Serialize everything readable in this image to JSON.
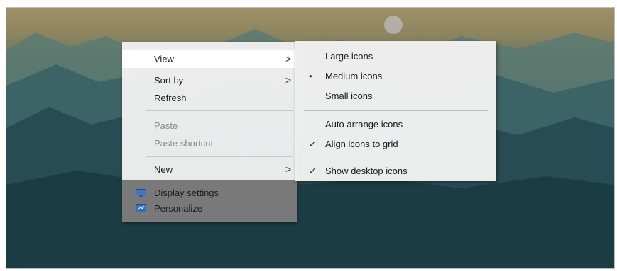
{
  "context_menu": {
    "items": [
      {
        "label": "View",
        "arrow": ">",
        "state": "highlighted"
      },
      {
        "label": "Sort by",
        "arrow": ">"
      },
      {
        "label": "Refresh"
      },
      {
        "label": "Paste",
        "state": "disabled"
      },
      {
        "label": "Paste shortcut",
        "state": "disabled"
      },
      {
        "label": "New",
        "arrow": ">"
      }
    ],
    "extra_items": [
      {
        "label": "Display settings",
        "icon": "display-settings-icon"
      },
      {
        "label": "Personalize",
        "icon": "personalize-icon"
      }
    ]
  },
  "view_submenu": {
    "items": [
      {
        "label": "Large icons",
        "mark": ""
      },
      {
        "label": "Medium icons",
        "mark": "•"
      },
      {
        "label": "Small icons",
        "mark": ""
      },
      {
        "label": "Auto arrange icons",
        "mark": ""
      },
      {
        "label": "Align icons to grid",
        "mark": "✓"
      },
      {
        "label": "Show desktop icons",
        "mark": "✓"
      }
    ]
  },
  "watermark": {
    "text": "TipsMake",
    "suffix": ".com"
  },
  "colors": {
    "highlight": "#ffffff",
    "menu_bg": "#f0f0f0",
    "disabled_text": "#8d8d8d"
  }
}
